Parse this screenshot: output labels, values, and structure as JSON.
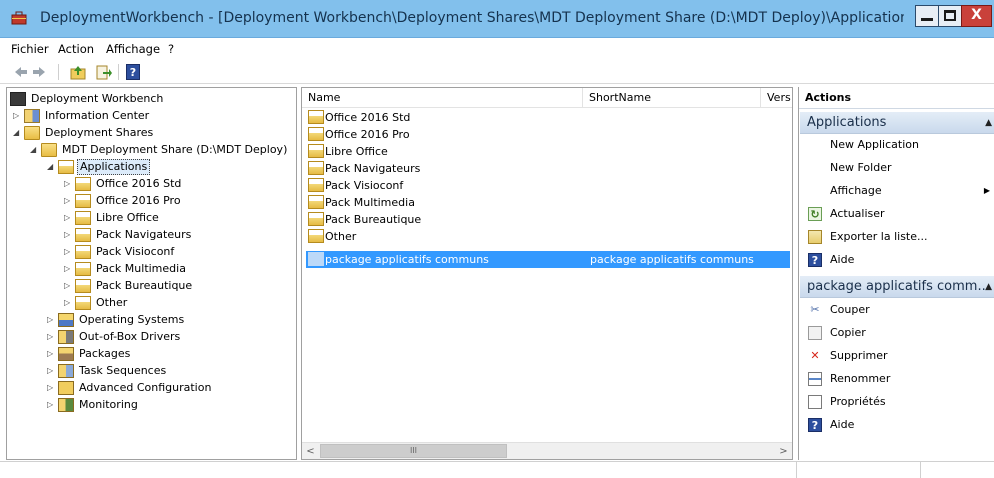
{
  "window": {
    "title": "DeploymentWorkbench - [Deployment Workbench\\Deployment Shares\\MDT Deployment Share (D:\\MDT Deploy)\\Applications]",
    "min_icon": "minimize-icon",
    "max_icon": "maximize-icon",
    "close_label": "X"
  },
  "menu": {
    "items": [
      "Fichier",
      "Action",
      "Affichage",
      "?"
    ]
  },
  "toolbar": {
    "icons": [
      "back-arrow-icon",
      "forward-arrow-icon",
      "up-folder-icon",
      "export-list-icon",
      "help-icon"
    ],
    "help_label": "?"
  },
  "tree": {
    "items": [
      {
        "label": "Deployment Workbench",
        "icon": "workbench-icon",
        "expanded": true
      },
      {
        "label": "Information Center",
        "icon": "info-center-icon",
        "expanded": false
      },
      {
        "label": "Deployment Shares",
        "icon": "folder-icon",
        "expanded": true
      },
      {
        "label": "MDT Deployment Share (D:\\MDT Deploy)",
        "icon": "share-folder-icon",
        "expanded": true
      },
      {
        "label": "Applications",
        "icon": "applications-folder-icon",
        "expanded": true,
        "selected": true
      },
      {
        "label": "Office 2016 Std",
        "icon": "folder-icon",
        "expanded": false
      },
      {
        "label": "Office 2016 Pro",
        "icon": "folder-icon",
        "expanded": false
      },
      {
        "label": "Libre Office",
        "icon": "folder-icon",
        "expanded": false
      },
      {
        "label": "Pack Navigateurs",
        "icon": "folder-icon",
        "expanded": false
      },
      {
        "label": "Pack Visioconf",
        "icon": "folder-icon",
        "expanded": false
      },
      {
        "label": "Pack Multimedia",
        "icon": "folder-icon",
        "expanded": false
      },
      {
        "label": "Pack Bureautique",
        "icon": "folder-icon",
        "expanded": false
      },
      {
        "label": "Other",
        "icon": "folder-icon",
        "expanded": false
      },
      {
        "label": "Operating Systems",
        "icon": "operating-systems-icon",
        "expanded": false
      },
      {
        "label": "Out-of-Box Drivers",
        "icon": "drivers-icon",
        "expanded": false
      },
      {
        "label": "Packages",
        "icon": "packages-icon",
        "expanded": false
      },
      {
        "label": "Task Sequences",
        "icon": "task-sequences-icon",
        "expanded": false
      },
      {
        "label": "Advanced Configuration",
        "icon": "advanced-config-icon",
        "expanded": false
      },
      {
        "label": "Monitoring",
        "icon": "monitoring-icon",
        "expanded": false
      }
    ]
  },
  "list": {
    "columns": [
      "Name",
      "ShortName",
      "Vers"
    ],
    "rows": [
      {
        "name": "Office 2016 Std",
        "shortname": "",
        "icon": "folder-icon"
      },
      {
        "name": "Office 2016 Pro",
        "shortname": "",
        "icon": "folder-icon"
      },
      {
        "name": "Libre Office",
        "shortname": "",
        "icon": "folder-icon"
      },
      {
        "name": "Pack Navigateurs",
        "shortname": "",
        "icon": "folder-icon"
      },
      {
        "name": "Pack Visioconf",
        "shortname": "",
        "icon": "folder-icon"
      },
      {
        "name": "Pack Multimedia",
        "shortname": "",
        "icon": "folder-icon"
      },
      {
        "name": "Pack Bureautique",
        "shortname": "",
        "icon": "folder-icon"
      },
      {
        "name": "Other",
        "shortname": "",
        "icon": "folder-icon"
      },
      {
        "name": "package applicatifs communs",
        "shortname": "package applicatifs communs",
        "icon": "application-icon",
        "selected": true
      }
    ],
    "scroll_thumb_label": "III"
  },
  "actions": {
    "header": "Actions",
    "sections": [
      {
        "title": "Applications",
        "items": [
          {
            "label": "New Application",
            "icon": ""
          },
          {
            "label": "New Folder",
            "icon": ""
          },
          {
            "label": "Affichage",
            "icon": "",
            "submenu": true
          },
          {
            "label": "Actualiser",
            "icon": "refresh-icon"
          },
          {
            "label": "Exporter la liste...",
            "icon": "export-list-icon"
          },
          {
            "label": "Aide",
            "icon": "help-icon"
          }
        ]
      },
      {
        "title": "package applicatifs comm...",
        "items": [
          {
            "label": "Couper",
            "icon": "cut-icon"
          },
          {
            "label": "Copier",
            "icon": "copy-icon"
          },
          {
            "label": "Supprimer",
            "icon": "delete-icon"
          },
          {
            "label": "Renommer",
            "icon": "rename-icon"
          },
          {
            "label": "Propriétés",
            "icon": "properties-icon"
          },
          {
            "label": "Aide",
            "icon": "help-icon"
          }
        ]
      }
    ]
  }
}
